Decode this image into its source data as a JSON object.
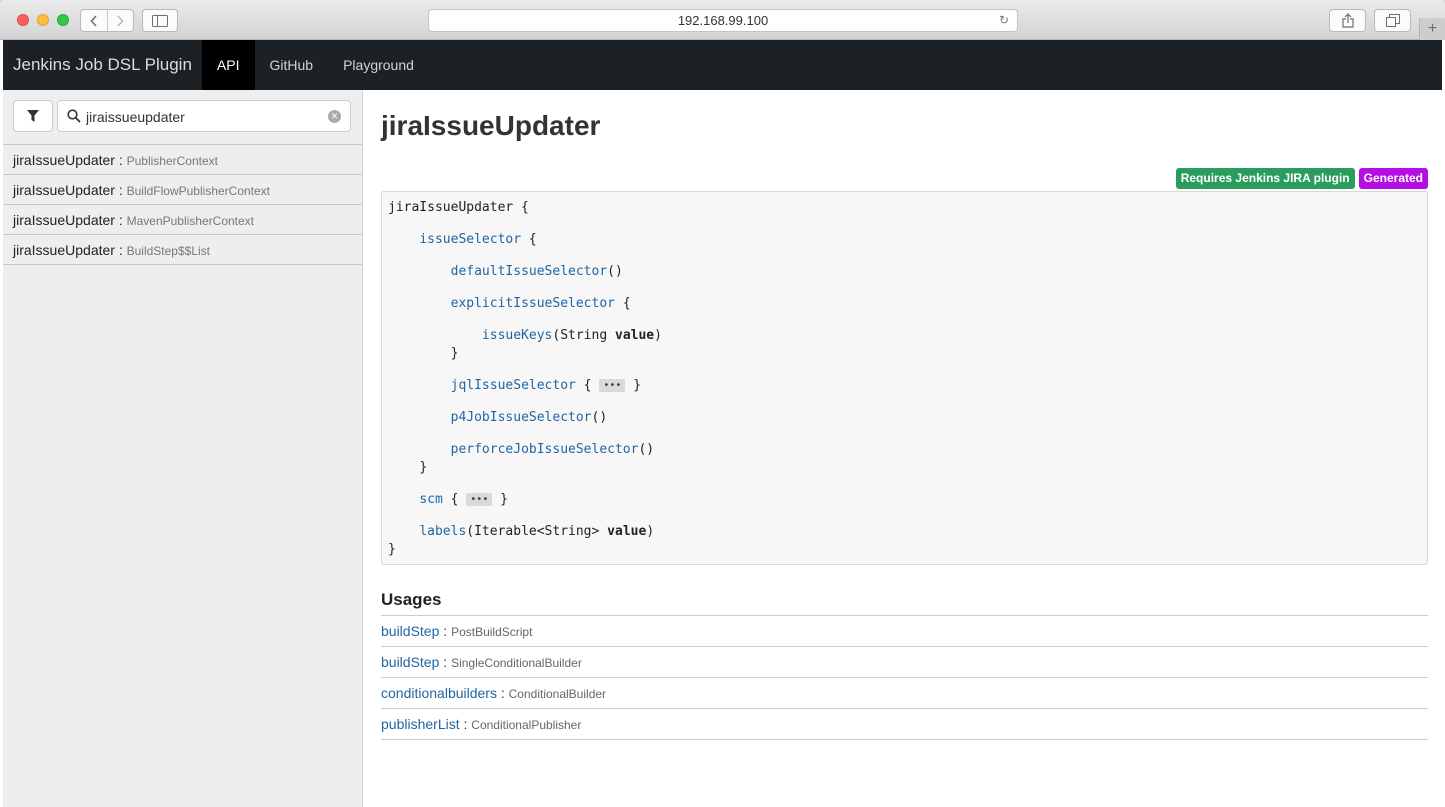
{
  "browser": {
    "url": "192.168.99.100"
  },
  "navbar": {
    "brand": "Jenkins Job DSL Plugin",
    "links": [
      {
        "label": "API",
        "active": true
      },
      {
        "label": "GitHub",
        "active": false
      },
      {
        "label": "Playground",
        "active": false
      }
    ]
  },
  "search": {
    "value": "jiraissueupdater"
  },
  "results": [
    {
      "name": "jiraIssueUpdater",
      "sep": " : ",
      "context": "PublisherContext"
    },
    {
      "name": "jiraIssueUpdater",
      "sep": " : ",
      "context": "BuildFlowPublisherContext"
    },
    {
      "name": "jiraIssueUpdater",
      "sep": " : ",
      "context": "MavenPublisherContext"
    },
    {
      "name": "jiraIssueUpdater",
      "sep": " : ",
      "context": "BuildStep$$List"
    }
  ],
  "main": {
    "title": "jiraIssueUpdater",
    "badges": {
      "plugin": "Requires Jenkins JIRA plugin",
      "generated": "Generated"
    },
    "code": {
      "root": "jiraIssueUpdater",
      "open": " {",
      "close": "}",
      "issueSelector": "issueSelector",
      "defaultIssueSelector": "defaultIssueSelector",
      "parens": "()",
      "explicitIssueSelector": "explicitIssueSelector",
      "issueKeys": "issueKeys",
      "issueKeysArgs": "(String ",
      "value": "value",
      "closeParen": ")",
      "jqlIssueSelector": "jqlIssueSelector",
      "p4JobIssueSelector": "p4JobIssueSelector",
      "perforceJobIssueSelector": "perforceJobIssueSelector",
      "scm": "scm",
      "labels": "labels",
      "labelsArgs": "(Iterable<String> ",
      "collapsed": "•••"
    },
    "usages_heading": "Usages",
    "usages": [
      {
        "name": "buildStep",
        "sep": " : ",
        "context": "PostBuildScript"
      },
      {
        "name": "buildStep",
        "sep": " : ",
        "context": "SingleConditionalBuilder"
      },
      {
        "name": "conditionalbuilders",
        "sep": " : ",
        "context": "ConditionalBuilder"
      },
      {
        "name": "publisherList",
        "sep": " : ",
        "context": "ConditionalPublisher"
      }
    ]
  },
  "icons": [
    "chevron-left-icon",
    "chevron-right-icon",
    "sidebar-icon",
    "reload-icon",
    "share-icon",
    "tabs-icon",
    "plus-icon",
    "filter-icon",
    "search-icon",
    "clear-icon"
  ],
  "colors": {
    "navbar_bg": "#1b2125",
    "link": "#2265a3",
    "badge_green": "#2a9d5c",
    "badge_purple": "#b50ee5"
  }
}
